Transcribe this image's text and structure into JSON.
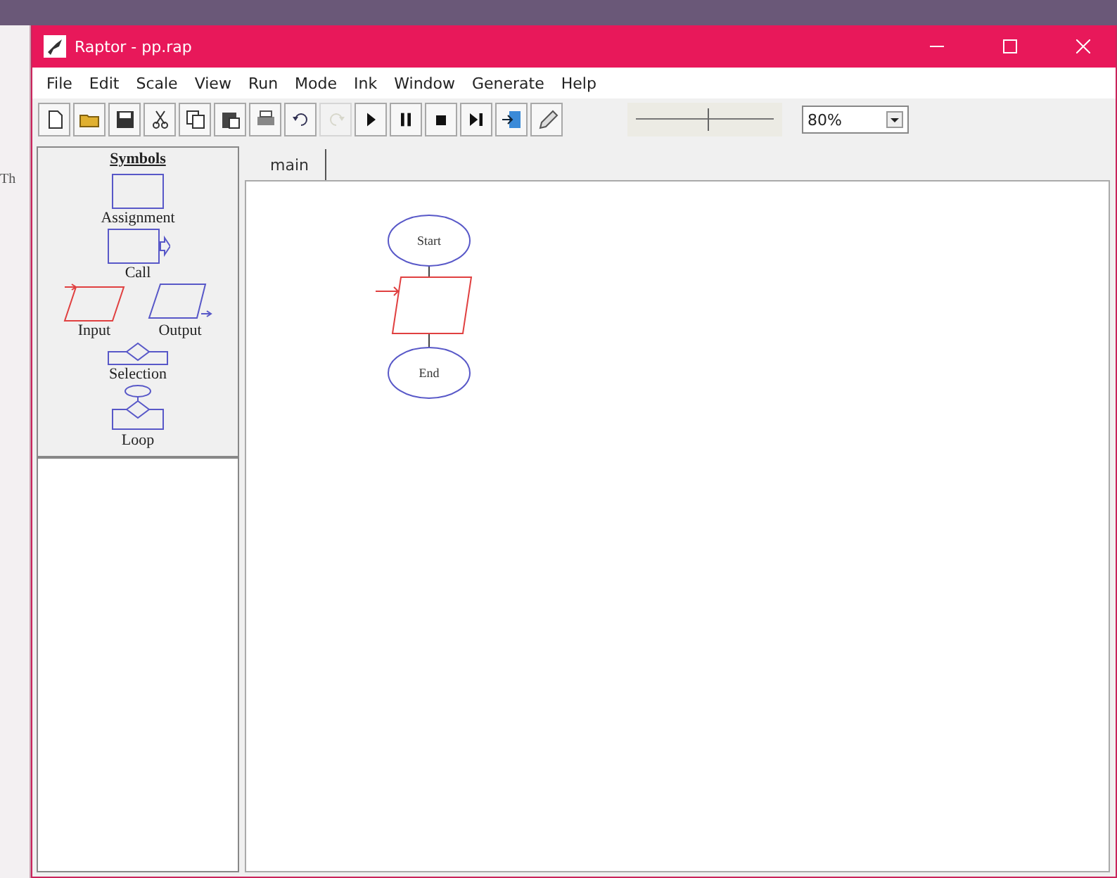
{
  "background_window": {
    "text": "Th"
  },
  "window": {
    "title": "Raptor - pp.rap"
  },
  "menu": [
    "File",
    "Edit",
    "Scale",
    "View",
    "Run",
    "Mode",
    "Ink",
    "Window",
    "Generate",
    "Help"
  ],
  "toolbar": [
    {
      "kind": "new",
      "disabled": false
    },
    {
      "kind": "open",
      "disabled": false
    },
    {
      "kind": "save",
      "disabled": false
    },
    {
      "kind": "cut",
      "disabled": false
    },
    {
      "kind": "copy",
      "disabled": false
    },
    {
      "kind": "paste",
      "disabled": false
    },
    {
      "kind": "print",
      "disabled": false
    },
    {
      "kind": "undo",
      "disabled": false
    },
    {
      "kind": "redo",
      "disabled": true
    },
    {
      "kind": "play",
      "disabled": false
    },
    {
      "kind": "pause",
      "disabled": false
    },
    {
      "kind": "stop",
      "disabled": false
    },
    {
      "kind": "step",
      "disabled": false
    },
    {
      "kind": "test",
      "disabled": false
    },
    {
      "kind": "pen",
      "disabled": false
    }
  ],
  "speed_slider": {
    "level": 0.55
  },
  "zoom": {
    "value": "80%"
  },
  "symbols": {
    "title": "Symbols",
    "items": [
      {
        "kind": "assignment",
        "label": "Assignment"
      },
      {
        "kind": "call",
        "label": "Call"
      },
      {
        "kind": "input",
        "label": "Input"
      },
      {
        "kind": "output",
        "label": "Output"
      },
      {
        "kind": "selection",
        "label": "Selection"
      },
      {
        "kind": "loop",
        "label": "Loop"
      }
    ]
  },
  "tabs": [
    {
      "label": "main",
      "selected": true
    }
  ],
  "flowchart": {
    "nodes": [
      {
        "kind": "start",
        "label": "Start"
      },
      {
        "kind": "input"
      },
      {
        "kind": "end",
        "label": "End"
      }
    ]
  }
}
